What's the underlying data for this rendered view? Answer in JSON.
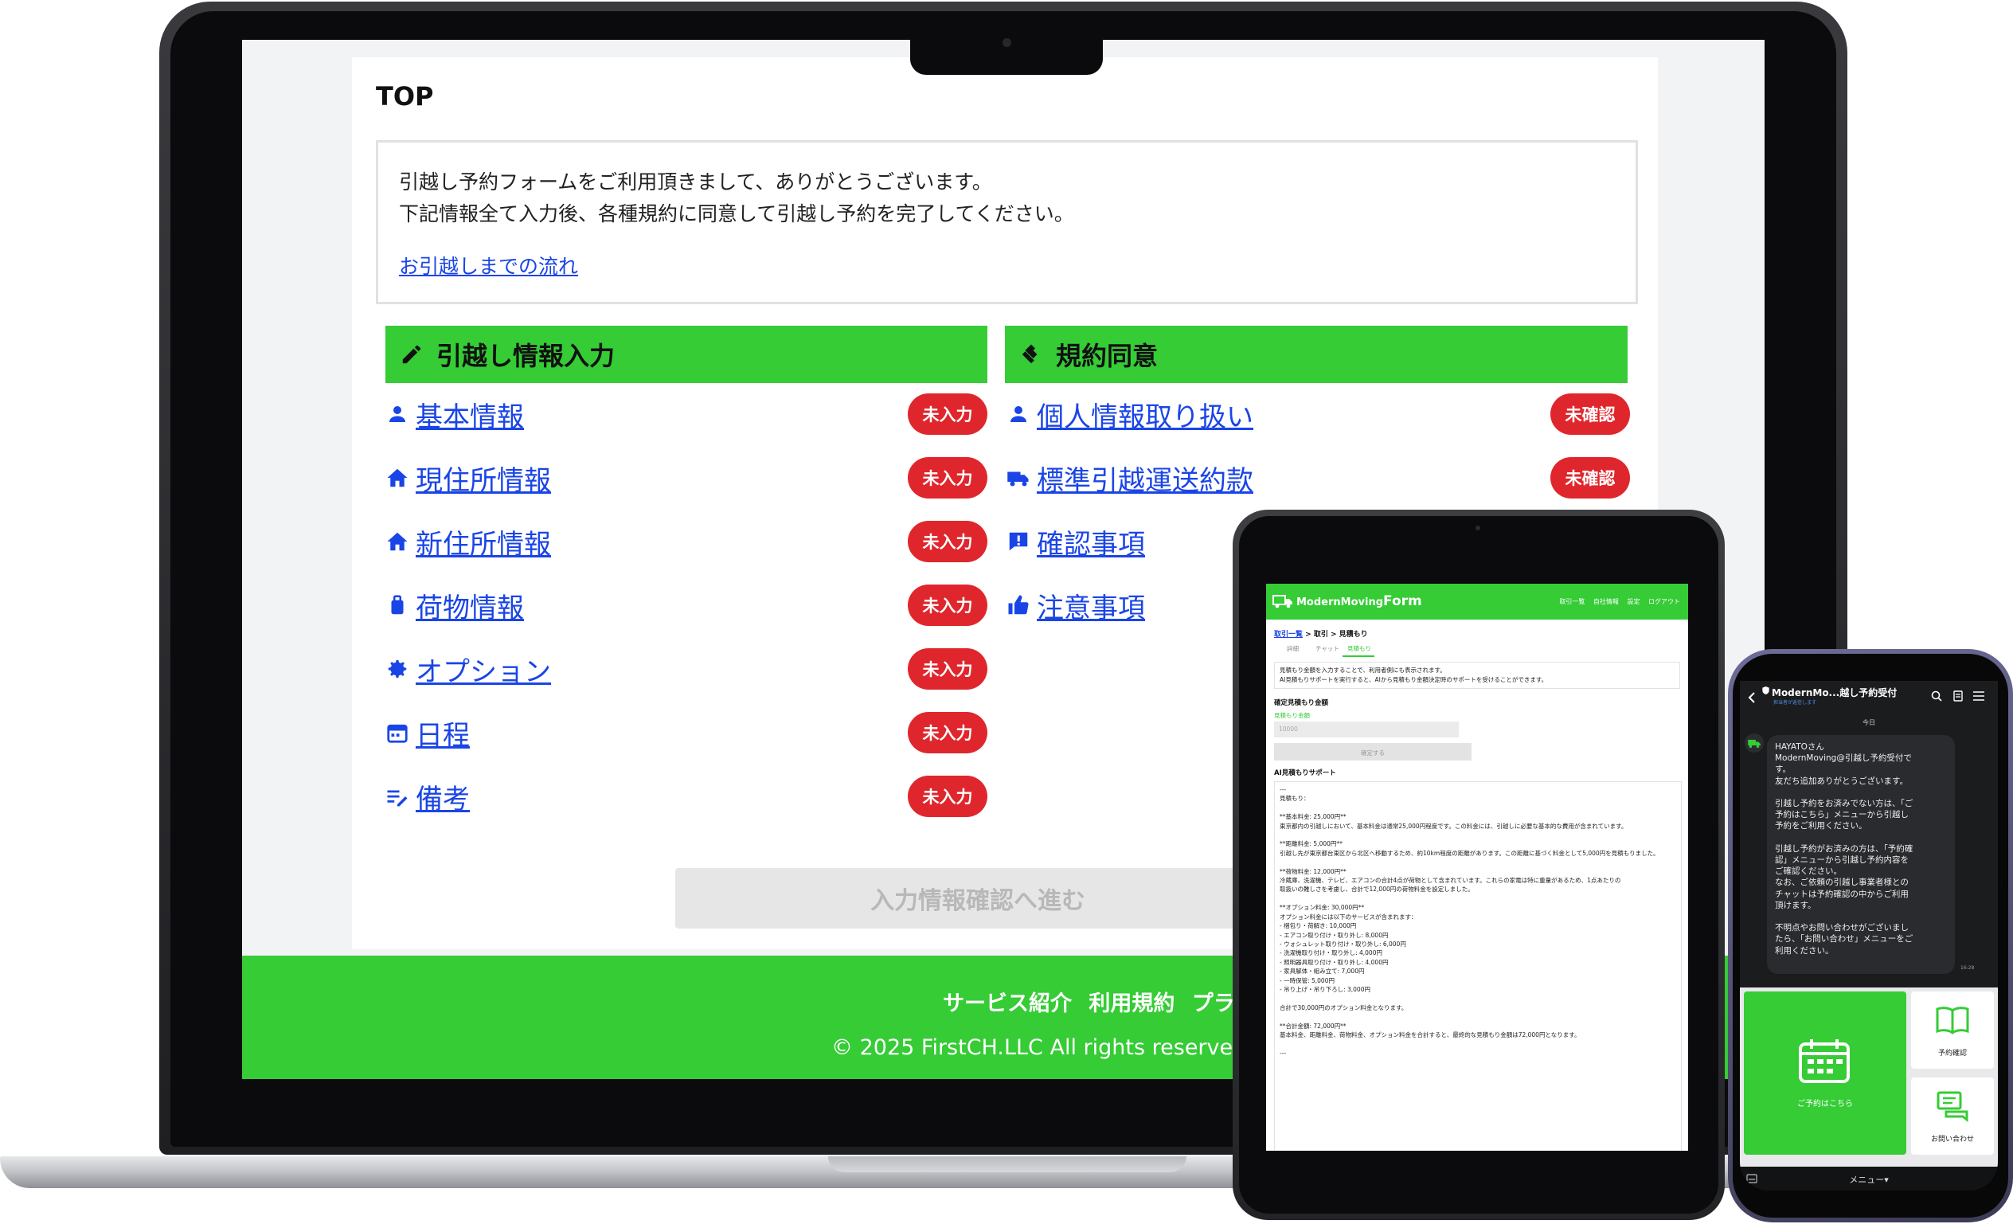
{
  "laptop": {
    "page_title": "TOP",
    "notice": {
      "line1": "引越し予約フォームをご利用頂きまして、ありがとうございます。",
      "line2": "下記情報全て入力後、各種規約に同意して引越し予約を完了してください。",
      "flow_link": "お引越しまでの流れ"
    },
    "info_section": {
      "title": "引越し情報入力",
      "items": [
        {
          "label": "基本情報",
          "icon": "person-icon",
          "status": "未入力"
        },
        {
          "label": "現住所情報",
          "icon": "home-icon",
          "status": "未入力"
        },
        {
          "label": "新住所情報",
          "icon": "home-icon",
          "status": "未入力"
        },
        {
          "label": "荷物情報",
          "icon": "luggage-icon",
          "status": "未入力"
        },
        {
          "label": "オプション",
          "icon": "gear-icon",
          "status": "未入力"
        },
        {
          "label": "日程",
          "icon": "calendar-icon",
          "status": "未入力"
        },
        {
          "label": "備考",
          "icon": "note-edit-icon",
          "status": "未入力"
        }
      ]
    },
    "terms_section": {
      "title": "規約同意",
      "items": [
        {
          "label": "個人情報取り扱い",
          "icon": "person-icon",
          "status": "未確認"
        },
        {
          "label": "標準引越運送約款",
          "icon": "truck-icon",
          "status": "未確認"
        },
        {
          "label": "確認事項",
          "icon": "alert-icon",
          "status": ""
        },
        {
          "label": "注意事項",
          "icon": "thumbs-up-icon",
          "status": ""
        }
      ]
    },
    "proceed_button": "入力情報確認へ進む",
    "footer": {
      "links": [
        "サービス紹介",
        "利用規約",
        "プライ"
      ],
      "copyright": "© 2025 FirstCH.LLC All rights reserved."
    }
  },
  "tablet": {
    "brand_prefix": "ModernMoving",
    "brand_suffix": "Form",
    "nav": [
      "取引一覧",
      "自社情報",
      "設定",
      "ログアウト"
    ],
    "breadcrumb_link": "取引一覧",
    "breadcrumb_rest": " > 取引 > 見積もり",
    "tabs": [
      "詳細",
      "チャット",
      "見積もり"
    ],
    "info_line1": "見積もり金額を入力することで、利用者側にも表示されます。",
    "info_line2": "AI見積もりサポートを実行すると、AIから見積もり金額決定時のサポートを受けることができます。",
    "confirmed_heading": "確定見積もり金額",
    "amount_label": "見積もり金額",
    "amount_placeholder": "10000",
    "confirm_button": "確定する",
    "ai_heading": "AI見積もりサポート",
    "ai_lines": [
      "---",
      "見積もり：",
      "",
      "**基本料金: 25,000円**",
      "東京都内の引越しにおいて、基本料金は通常25,000円程度です。この料金には、引越しに必要な基本的な費用が含まれています。",
      "",
      "**距離料金: 5,000円**",
      "引越し先が東京都台東区から北区へ移動するため、約10km程度の距離があります。この距離に基づく料金として5,000円を見積もりました。",
      "",
      "**荷物料金: 12,000円**",
      "冷蔵庫、洗濯機、テレビ、エアコンの合計4点が荷物として含まれています。これらの家電は特に重量があるため、1点あたりの",
      "取扱いの難しさを考慮し、合計で12,000円の荷物料金を設定しました。",
      "",
      "**オプション料金: 30,000円**",
      "オプション料金には以下のサービスが含まれます：",
      "- 梱包り・荷解き: 10,000円",
      "- エアコン取り付け・取り外し: 8,000円",
      "- ウォシュレット取り付け・取り外し: 6,000円",
      "- 洗濯機取り付け・取り外し: 4,000円",
      "- 照明器具取り付け・取り外し: 4,000円",
      "- 家具解体・組み立て: 7,000円",
      "- 一時保管: 5,000円",
      "- 吊り上げ・吊り下ろし: 3,000円",
      "",
      "合計で30,000円のオプション料金となります。",
      "",
      "**合計金額: 72,000円**",
      "基本料金、距離料金、荷物料金、オプション料金を合計すると、最終的な見積もり金額は72,000円となります。",
      "",
      "---"
    ]
  },
  "phone": {
    "chat_title": "ModernMo...越し予約受付",
    "chat_subtitle": "担当者が返信します",
    "day_label": "今日",
    "message": "HAYATOさん\nModernMoving@引越し予約受付で\nす。\n友だち追加ありがとうございます。\n\n引越し予約をお済みでない方は、「ご\n予約はこちら」メニューから引越し\n予約をご利用ください。\n\n引越し予約がお済みの方は、「予約確\n認」メニューから引越し予約内容を\nご確認ください。\nなお、ご依頼の引越し事業者様との\nチャットは予約確認の中からご利用\n頂けます。\n\n不明点やお問い合わせがございまし\nたら、「お問い合わせ」メニューをご\n利用ください。",
    "message_time": "16:28",
    "menu_main": "ご予約はこちら",
    "menu_confirm": "予約確認",
    "menu_contact": "お問い合わせ",
    "menu_bar": "メニュー▾"
  },
  "colors": {
    "brand_green": "#35cc35",
    "status_red": "#e0262d",
    "link_blue": "#1a45e6"
  }
}
